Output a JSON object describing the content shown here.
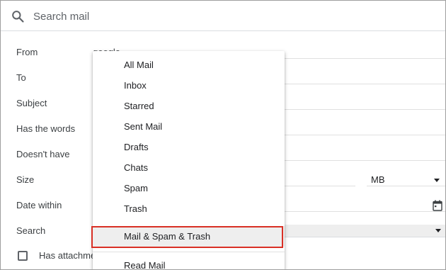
{
  "search": {
    "placeholder": "Search mail",
    "icon": "search-icon"
  },
  "form": {
    "labels": [
      "From",
      "To",
      "Subject",
      "Has the words",
      "Doesn't have",
      "Size",
      "Date within",
      "Search"
    ],
    "from_value": "google",
    "size_unit": "MB",
    "has_attachment_label": "Has attachment"
  },
  "dropdown": {
    "items": [
      "All Mail",
      "Inbox",
      "Starred",
      "Sent Mail",
      "Drafts",
      "Chats",
      "Spam",
      "Trash"
    ],
    "highlighted": "Mail & Spam & Trash",
    "after_separator": [
      "Read Mail"
    ]
  },
  "colors": {
    "highlight_border": "#d93025",
    "selected_bg": "#eeeeee"
  }
}
